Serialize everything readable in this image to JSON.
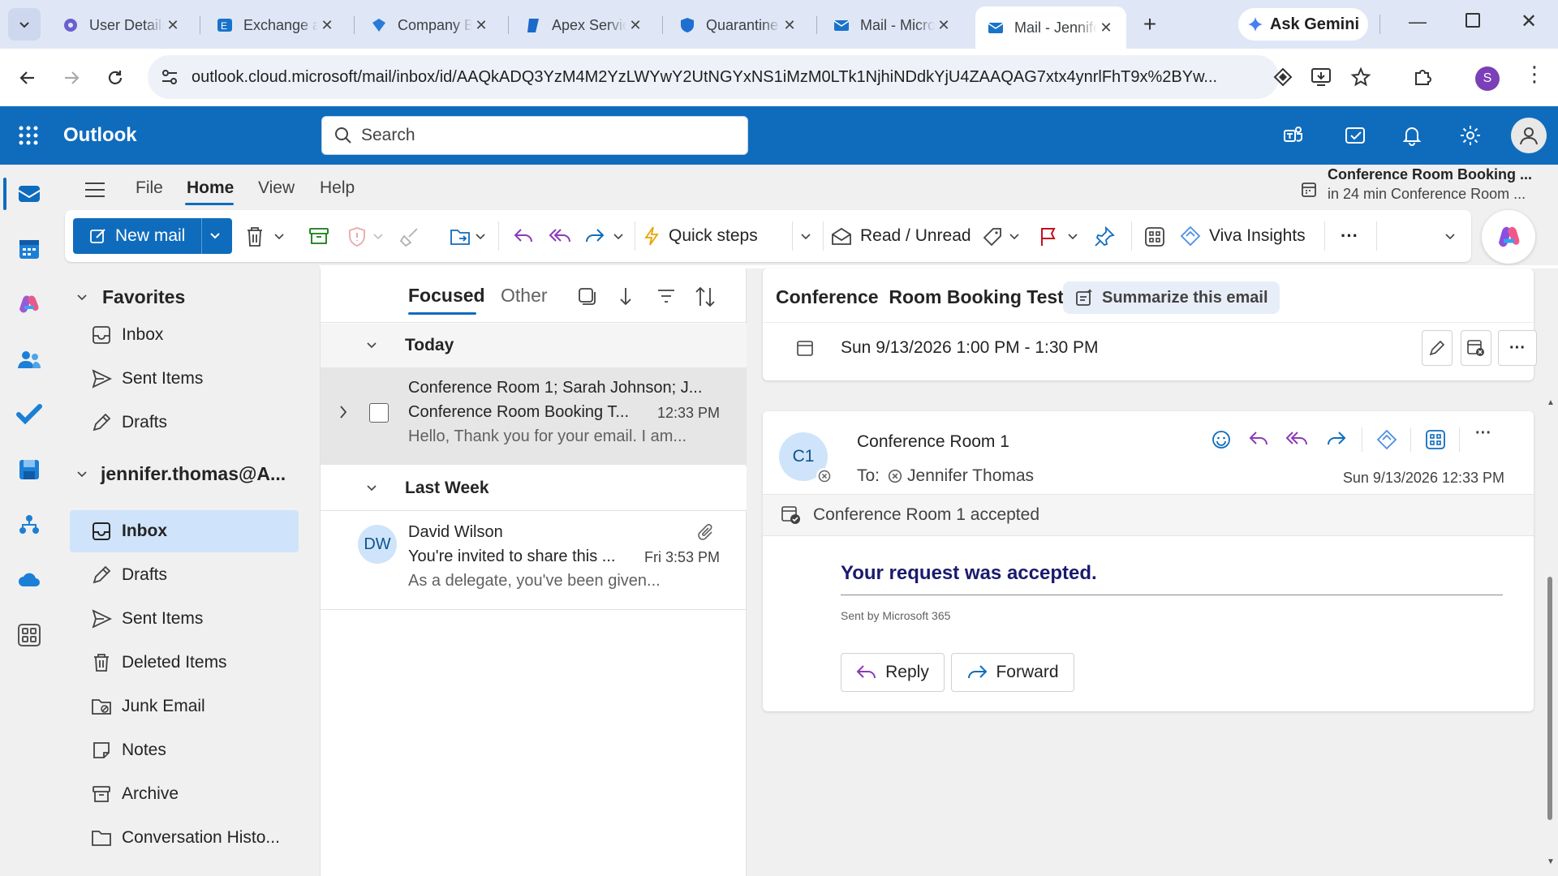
{
  "browser": {
    "tabs": [
      {
        "title": "User Details"
      },
      {
        "title": "Exchange admin"
      },
      {
        "title": "Company Branding"
      },
      {
        "title": "Apex Services"
      },
      {
        "title": "Quarantine"
      },
      {
        "title": "Mail - Microsoft"
      },
      {
        "title": "Mail - Jennifer"
      }
    ],
    "ask_gemini": "Ask Gemini",
    "url": "outlook.cloud.microsoft/mail/inbox/id/AAQkADQ3YzM4M2YzLWYwY2UtNGYxNS1iMzM0LTk1NjhiNDdkYjU4ZAAQAG7xtx4ynrlFhT9x%2BYw...",
    "profile_initial": "S"
  },
  "outlook": {
    "app_name": "Outlook",
    "search_placeholder": "Search",
    "brand_color": "#0f6cbd"
  },
  "menu": {
    "file": "File",
    "home": "Home",
    "view": "View",
    "help": "Help"
  },
  "reminder": {
    "title": "Conference Room Booking ...",
    "subtitle": "in 24 min Conference Room ..."
  },
  "toolbar": {
    "new_mail": "New mail",
    "quick_steps": "Quick steps",
    "read_unread": "Read / Unread",
    "viva_insights": "Viva Insights",
    "more": "···"
  },
  "folders": {
    "favorites_label": "Favorites",
    "favorites": [
      "Inbox",
      "Sent Items",
      "Drafts"
    ],
    "account_label": "jennifer.thomas@A...",
    "account_items": [
      "Inbox",
      "Drafts",
      "Sent Items",
      "Deleted Items",
      "Junk Email",
      "Notes",
      "Archive",
      "Conversation Histo..."
    ]
  },
  "message_list": {
    "tab_focused": "Focused",
    "tab_other": "Other",
    "group_today": "Today",
    "group_last_week": "Last Week",
    "messages": [
      {
        "sender": "Conference Room 1; Sarah Johnson; J...",
        "subject": "Conference Room Booking T...",
        "time": "12:33 PM",
        "preview": "Hello, Thank you for your email. I am..."
      },
      {
        "initials": "DW",
        "sender": "David Wilson",
        "subject": "You're invited to share this ...",
        "time": "Fri 3:53 PM",
        "preview": "As a delegate, you've been given..."
      }
    ]
  },
  "reading": {
    "subject_part1": "Conference",
    "subject_part2": "Room Booking Test",
    "summarize": "Summarize this email",
    "event_time": "Sun 9/13/2026 1:00 PM - 1:30 PM",
    "from": "Conference Room 1",
    "from_initials": "C1",
    "to_label": "To:",
    "to_name": "Jennifer Thomas",
    "sent_time": "Sun 9/13/2026 12:33 PM",
    "accepted_banner": "Conference Room 1 accepted",
    "body_heading": "Your request was accepted.",
    "body_footer": "Sent by Microsoft 365",
    "reply": "Reply",
    "forward": "Forward"
  }
}
